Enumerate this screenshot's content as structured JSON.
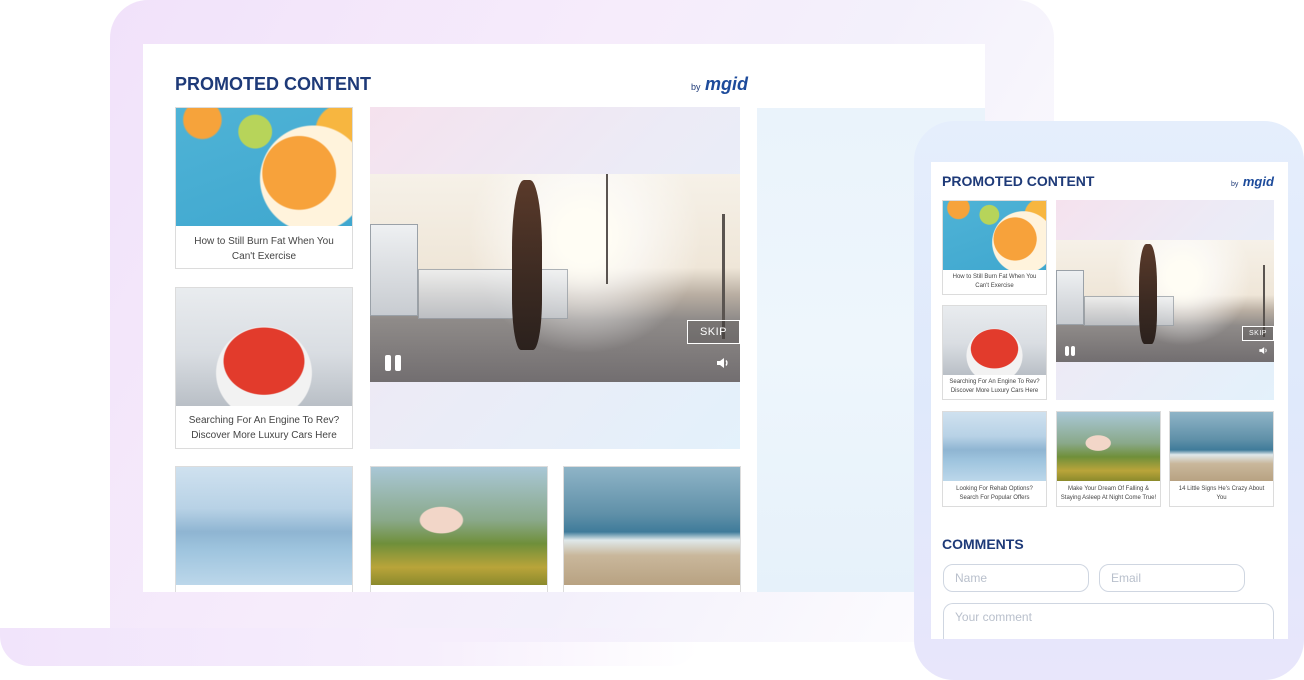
{
  "colors": {
    "title": "#1e3a78",
    "brand_text": "#1d4b9b",
    "caption_text": "#444444",
    "card_border": "#dcdcdc",
    "laptop_frame": "#f1e2fa",
    "tablet_frame": "#e5eefc"
  },
  "laptop": {
    "widget_title": "PROMOTED CONTENT",
    "brand": {
      "by": "by",
      "name": "mgid"
    },
    "cards": [
      {
        "image": "citrus-drink-photo",
        "caption": "How to Still Burn Fat When You Can't Exercise"
      },
      {
        "image": "red-convertible-photo",
        "caption": "Searching For An Engine To Rev? Discover More Luxury Cars Here"
      },
      {
        "image": "lake-swing-photo",
        "caption": ""
      },
      {
        "image": "floating-woman-photo",
        "caption": ""
      },
      {
        "image": "beach-woman-photo",
        "caption": ""
      }
    ],
    "video": {
      "skip_label": "SKIP",
      "image": "runner-street-photo"
    }
  },
  "tablet": {
    "widget_title": "PROMOTED CONTENT",
    "brand": {
      "by": "by",
      "name": "mgid"
    },
    "cards": [
      {
        "image": "citrus-drink-photo",
        "caption": "How to Still Burn Fat When You Can't Exercise"
      },
      {
        "image": "red-convertible-photo",
        "caption": "Searching For An Engine To Rev? Discover More Luxury Cars Here"
      },
      {
        "image": "lake-swing-photo",
        "caption": "Looking For Rehab Options? Search For Popular Offers"
      },
      {
        "image": "floating-woman-photo",
        "caption": "Make Your Dream Of Falling & Staying Asleep At Night Come True!"
      },
      {
        "image": "beach-woman-photo",
        "caption": "14 Little Signs He's Crazy About You"
      }
    ],
    "video": {
      "skip_label": "SKIP",
      "image": "runner-street-photo"
    },
    "comments": {
      "title": "COMMENTS",
      "name_placeholder": "Name",
      "email_placeholder": "Email",
      "comment_placeholder": "Your comment"
    }
  }
}
